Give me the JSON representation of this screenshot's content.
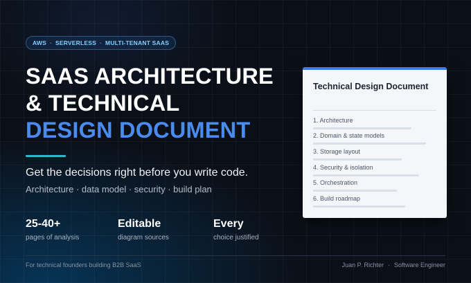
{
  "badge": {
    "items": [
      "AWS",
      "SERVERLESS",
      "MULTI-TENANT SAAS"
    ],
    "separator": "·"
  },
  "headline": {
    "line1": "SAAS ARCHITECTURE",
    "line2": "& TECHNICAL",
    "line3": "DESIGN DOCUMENT"
  },
  "tagline": "Get the decisions right before you write code.",
  "subtagline": "Architecture · data model · security · build plan",
  "stats": [
    {
      "value": "25-40+",
      "label": "pages of analysis"
    },
    {
      "value": "Editable",
      "label": "diagram sources"
    },
    {
      "value": "Every",
      "label": "choice justified"
    }
  ],
  "footer": {
    "left": "For technical founders building B2B SaaS",
    "author": "Juan P. Richter",
    "separator": "·",
    "role": "Software Engineer"
  },
  "doc_card": {
    "title": "Technical Design Document",
    "toc": [
      "1. Architecture",
      "2. Domain & state models",
      "3. Storage layout",
      "4. Security & isolation",
      "5. Orchestration",
      "6. Build roadmap"
    ]
  },
  "colors": {
    "background": "#0b1018",
    "accent_blue": "#4a8bf0",
    "accent_teal": "#2bb7cf",
    "badge_text": "#7fd0ff",
    "card_bg": "#f4f6fa",
    "card_top": "#3a7cf0"
  }
}
